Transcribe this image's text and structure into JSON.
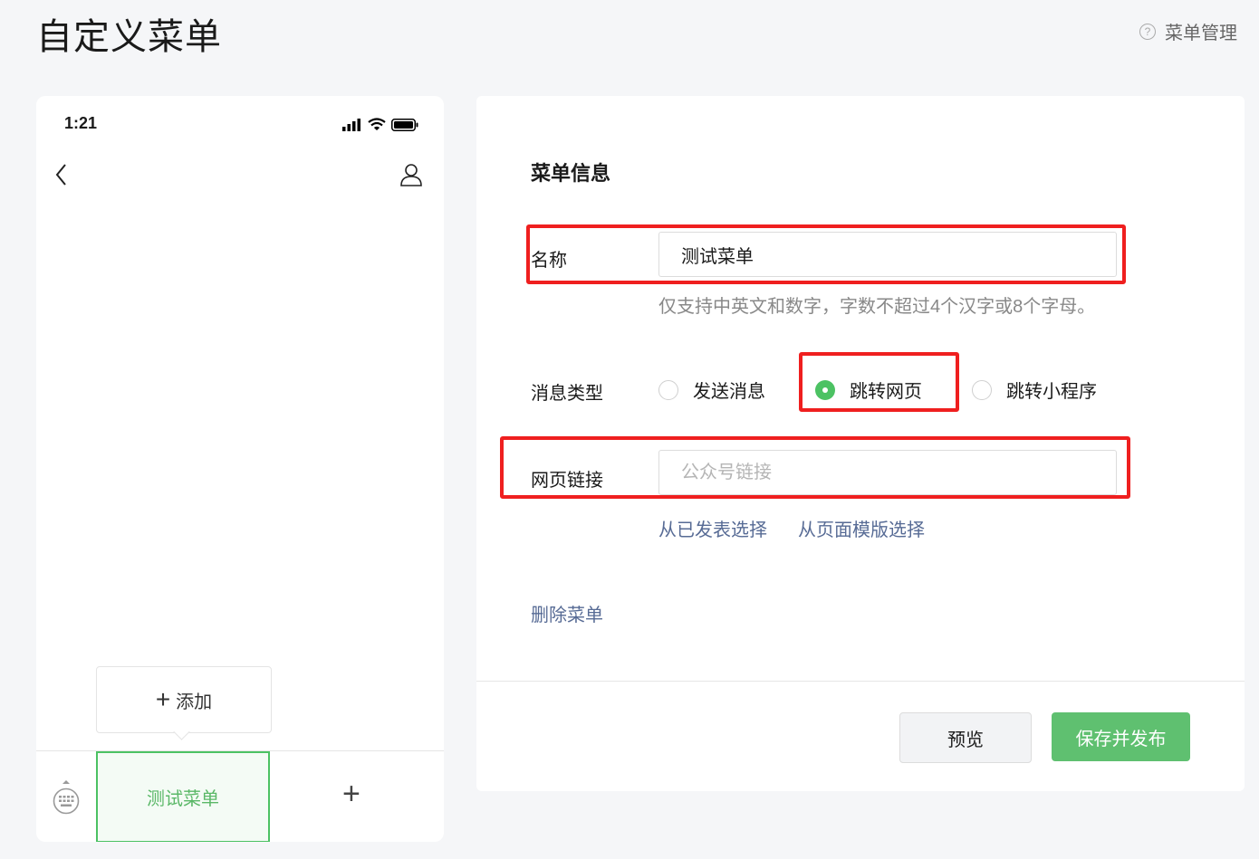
{
  "page": {
    "title": "自定义菜单",
    "menu_manage": "菜单管理"
  },
  "phone": {
    "time": "1:21",
    "add_label": "添加",
    "menu_item": "测试菜单"
  },
  "editor": {
    "section_title": "菜单信息",
    "name_label": "名称",
    "name_value": "测试菜单",
    "name_hint": "仅支持中英文和数字，字数不超过4个汉字或8个字母。",
    "msg_type_label": "消息类型",
    "msg_types": [
      {
        "label": "发送消息",
        "checked": false
      },
      {
        "label": "跳转网页",
        "checked": true
      },
      {
        "label": "跳转小程序",
        "checked": false
      }
    ],
    "link_label": "网页链接",
    "link_placeholder": "公众号链接",
    "link_from_published": "从已发表选择",
    "link_from_template": "从页面模版选择",
    "delete_label": "删除菜单",
    "preview_label": "预览",
    "publish_label": "保存并发布"
  },
  "colors": {
    "accent": "#4cc263",
    "link": "#576b95",
    "highlight": "#ef1f1f"
  }
}
